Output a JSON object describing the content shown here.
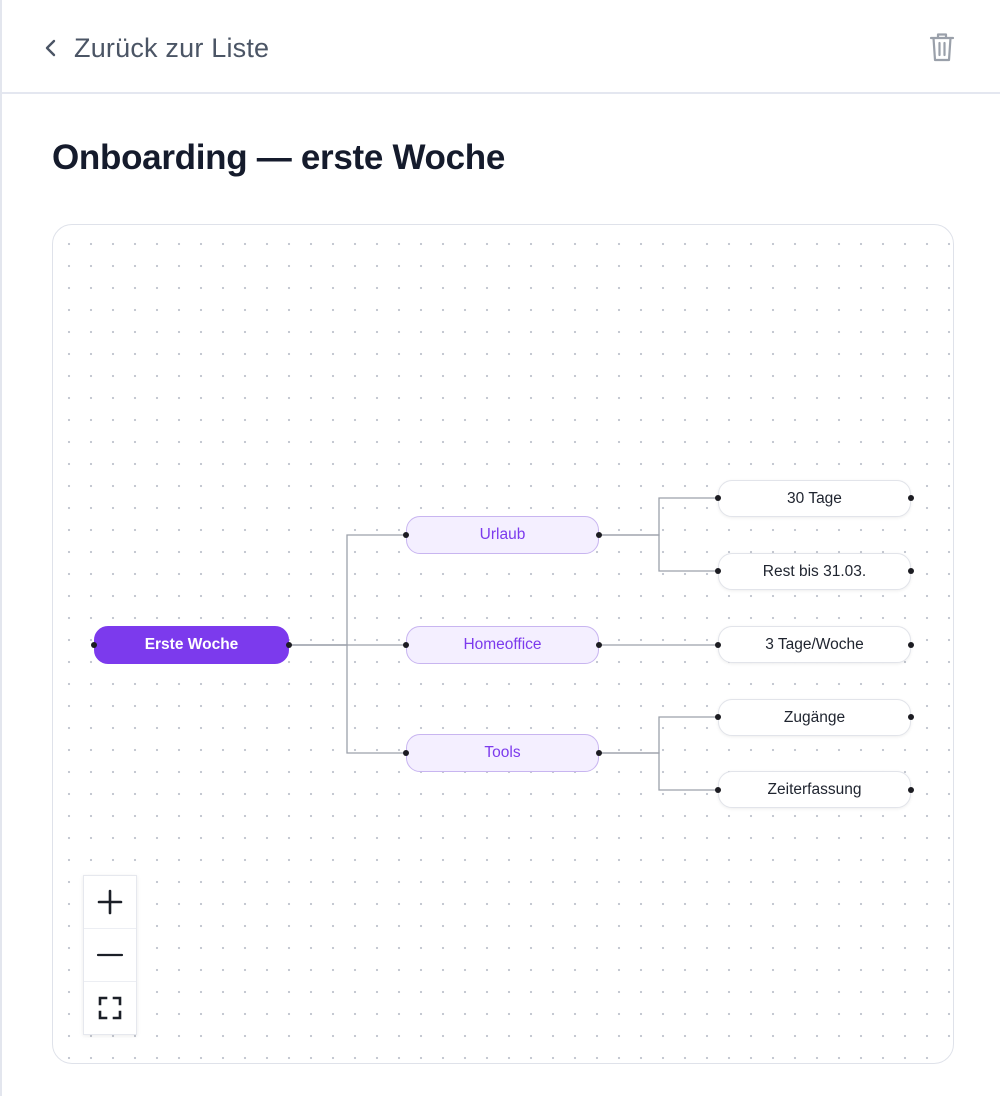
{
  "header": {
    "back_label": "Zurück zur Liste",
    "back_icon": "chevron-left-icon",
    "delete_icon": "trash-icon"
  },
  "page": {
    "title": "Onboarding — erste Woche"
  },
  "mindmap": {
    "root": {
      "label": "Erste Woche"
    },
    "branches": [
      {
        "label": "Urlaub",
        "children": [
          "30 Tage",
          "Rest bis 31.03."
        ]
      },
      {
        "label": "Homeoffice",
        "children": [
          "3 Tage/Woche"
        ]
      },
      {
        "label": "Tools",
        "children": [
          "Zugänge",
          "Zeiterfassung"
        ]
      }
    ]
  },
  "controls": {
    "zoom_in_icon": "plus-icon",
    "zoom_out_icon": "minus-icon",
    "fit_view_icon": "fit-view-icon"
  },
  "colors": {
    "accent": "#7c3aed",
    "branch_fill": "#f4efff",
    "branch_border": "#c8b5f0",
    "edge": "#9ca1ab"
  }
}
